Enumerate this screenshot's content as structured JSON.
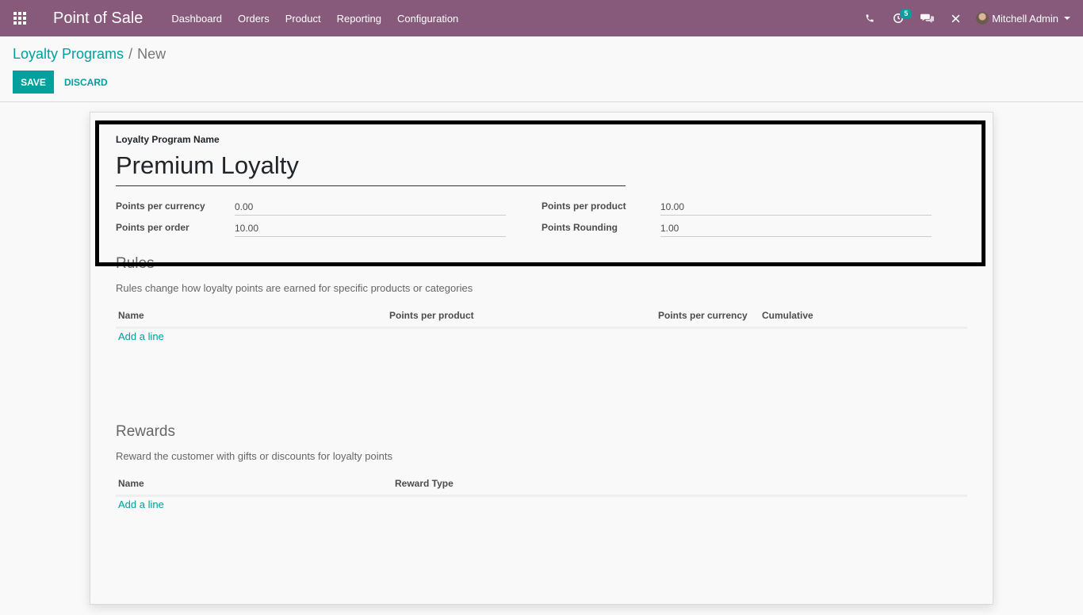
{
  "navbar": {
    "app_title": "Point of Sale",
    "menu": [
      "Dashboard",
      "Orders",
      "Product",
      "Reporting",
      "Configuration"
    ],
    "activity_count": "5",
    "user_name": "Mitchell Admin"
  },
  "breadcrumb": {
    "parent": "Loyalty Programs",
    "separator": "/",
    "current": "New"
  },
  "buttons": {
    "save": "SAVE",
    "discard": "DISCARD"
  },
  "form": {
    "name_label": "Loyalty Program Name",
    "name_value": "Premium Loyalty",
    "points_per_currency_label": "Points per currency",
    "points_per_currency_value": "0.00",
    "points_per_order_label": "Points per order",
    "points_per_order_value": "10.00",
    "points_per_product_label": "Points per product",
    "points_per_product_value": "10.00",
    "points_rounding_label": "Points Rounding",
    "points_rounding_value": "1.00"
  },
  "rules": {
    "title": "Rules",
    "description": "Rules change how loyalty points are earned for specific products or categories",
    "columns": [
      "Name",
      "Points per product",
      "Points per currency",
      "Cumulative"
    ],
    "add_line": "Add a line"
  },
  "rewards": {
    "title": "Rewards",
    "description": "Reward the customer with gifts or discounts for loyalty points",
    "columns": [
      "Name",
      "Reward Type"
    ],
    "add_line": "Add a line"
  },
  "colors": {
    "navbar": "#875a7b",
    "accent": "#00a09d"
  }
}
